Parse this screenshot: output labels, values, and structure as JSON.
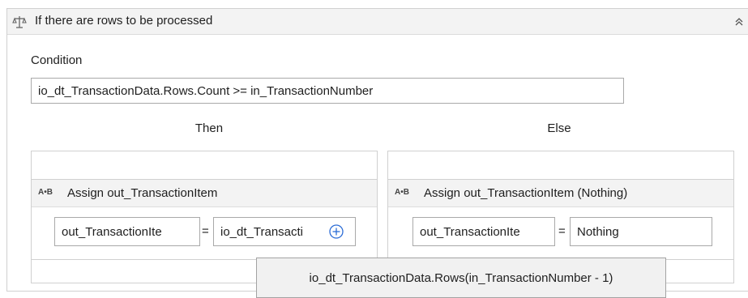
{
  "if_activity": {
    "title": "If there are rows to be processed",
    "icon": "if-decision-icon",
    "collapse_icon": "collapse-chevron-icon"
  },
  "condition": {
    "label": "Condition",
    "value": "io_dt_TransactionData.Rows.Count >= in_TransactionNumber"
  },
  "then": {
    "label": "Then",
    "assign": {
      "icon_text": "A•B",
      "title": "Assign out_TransactionItem",
      "to_value": "out_TransactionIte",
      "equals": "=",
      "value": "io_dt_Transacti",
      "add_icon": "plus-circle-icon"
    }
  },
  "else": {
    "label": "Else",
    "assign": {
      "icon_text": "A•B",
      "title": "Assign out_TransactionItem (Nothing)",
      "to_value": "out_TransactionIte",
      "equals": "=",
      "value": "Nothing"
    }
  },
  "tooltip": {
    "text": "io_dt_TransactionData.Rows(in_TransactionNumber - 1)"
  }
}
